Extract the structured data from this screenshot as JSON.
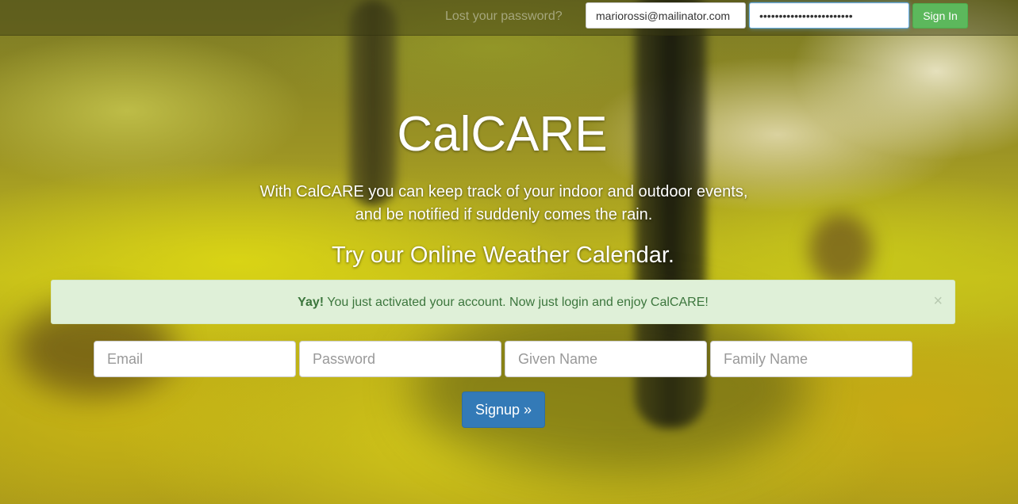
{
  "navbar": {
    "lost_password_link": "Lost your password?",
    "email_value": "mariorossi@mailinator.com",
    "password_value": "mariorossi1234567890abcd",
    "signin_label": "Sign In"
  },
  "hero": {
    "title": "CalCARE",
    "subtitle_line1": "With CalCARE you can keep track of your indoor and outdoor events,",
    "subtitle_line2": "and be notified if suddenly comes the rain.",
    "tagline": "Try our Online Weather Calendar."
  },
  "alert": {
    "strong": "Yay!",
    "message": " You just activated your account. Now just login and enjoy CalCARE!",
    "close": "×",
    "color": "#dff0d8"
  },
  "signup": {
    "email_placeholder": "Email",
    "password_placeholder": "Password",
    "given_name_placeholder": "Given Name",
    "family_name_placeholder": "Family Name",
    "button_label": "Signup »",
    "button_color": "#337ab7"
  },
  "colors": {
    "signin_button": "#5cb85c",
    "alert_text": "#3c763d"
  }
}
